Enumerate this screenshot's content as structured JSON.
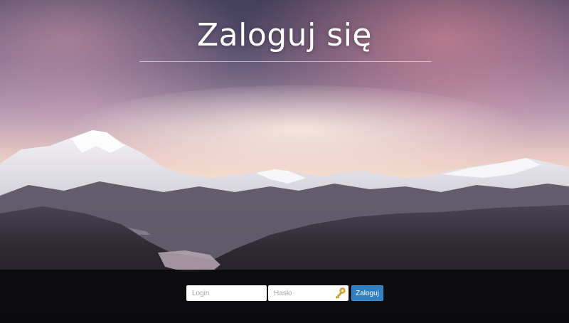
{
  "page": {
    "title": "Zaloguj się"
  },
  "login_form": {
    "login_placeholder": "Login",
    "login_value": "",
    "password_placeholder": "Hasło",
    "password_value": "",
    "submit_label": "Zaloguj"
  },
  "icons": {
    "password_field_icon": "key-icon"
  },
  "colors": {
    "submit_button": "#2f7fc1",
    "bottom_bar": "#0a0a0c",
    "title_text": "#ffffff"
  }
}
